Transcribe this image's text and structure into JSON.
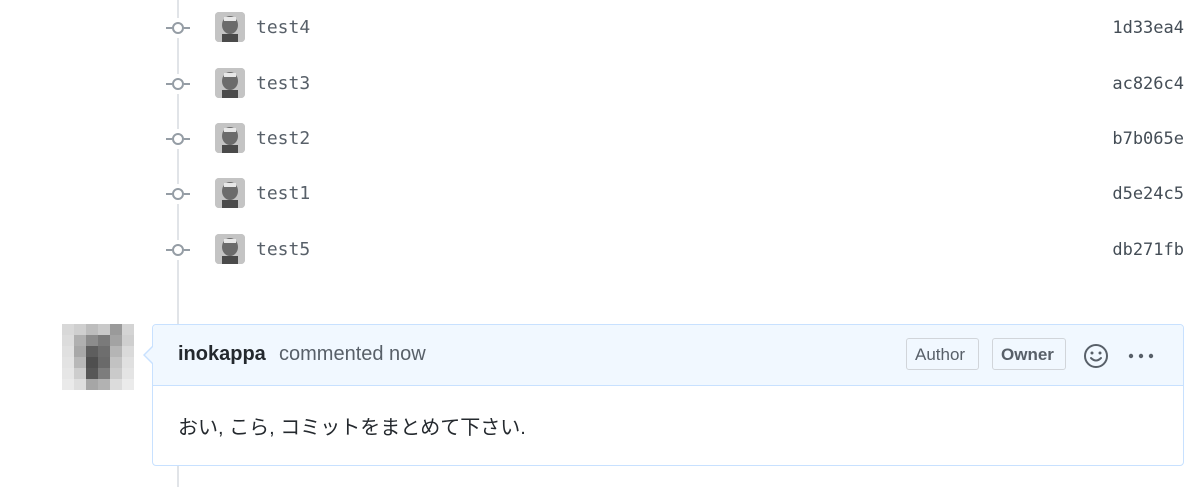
{
  "commits": [
    {
      "message": "test4",
      "sha": "1d33ea4"
    },
    {
      "message": "test3",
      "sha": "ac826c4"
    },
    {
      "message": "test2",
      "sha": "b7b065e"
    },
    {
      "message": "test1",
      "sha": "d5e24c5"
    },
    {
      "message": "test5",
      "sha": "db271fb"
    }
  ],
  "comment": {
    "author": "inokappa",
    "timestamp": "commented now",
    "badges": {
      "author": "Author",
      "owner": "Owner"
    },
    "body": "おい, こら, コミットをまとめて下さい.",
    "icons": {
      "reaction": "smiley-icon",
      "menu": "kebab-horizontal-icon"
    }
  },
  "colors": {
    "timeline": "#e1e4e8",
    "header_bg": "#f1f8ff",
    "header_border": "#c8e1ff"
  }
}
